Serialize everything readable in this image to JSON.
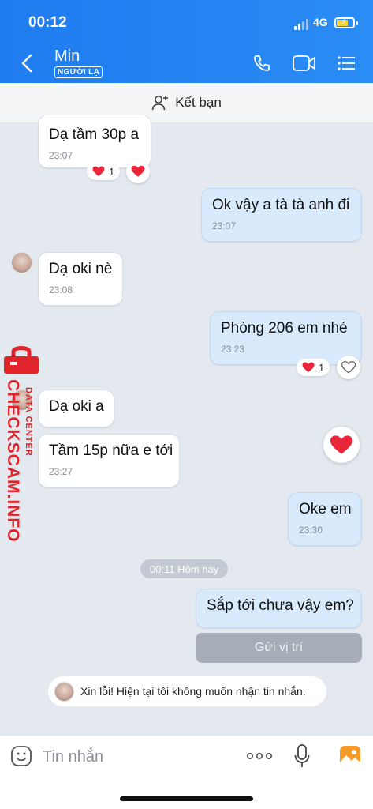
{
  "status_bar": {
    "time": "00:12",
    "network": "4G"
  },
  "header": {
    "contact_name": "Min",
    "stranger_badge": "NGƯỜI LẠ"
  },
  "add_friend": {
    "label": "Kết bạn"
  },
  "messages": [
    {
      "text": "Dạ tầm 30p a",
      "time": "23:07",
      "reaction_count": "1"
    },
    {
      "text": "Ok vậy a tà tà anh đi",
      "time": "23:07"
    },
    {
      "text": "Dạ oki nè",
      "time": "23:08"
    },
    {
      "text": "Phòng 206 em nhé",
      "time": "23:23",
      "reaction_count": "1"
    },
    {
      "text": "Dạ oki a"
    },
    {
      "text": "Tầm 15p nữa e tới",
      "time": "23:27"
    },
    {
      "text": "Oke em",
      "time": "23:30"
    },
    {
      "text": "Sắp tới chưa vậy em?"
    }
  ],
  "date_chip": "00:11 Hôm nay",
  "location_button": "Gửi vị trí",
  "notice": "Xin lỗi! Hiện tại tôi không muốn nhận tin nhắn.",
  "watermark": {
    "main": "CHECKSCAM.INFO",
    "sub": "DATA CENTER"
  },
  "composer": {
    "placeholder": "Tin nhắn"
  },
  "colors": {
    "header": "#2a8cf5",
    "outgoing_bubble": "#d8eafc",
    "background": "#e4e9f0",
    "heart": "#e8283a",
    "watermark": "#e0242a"
  }
}
